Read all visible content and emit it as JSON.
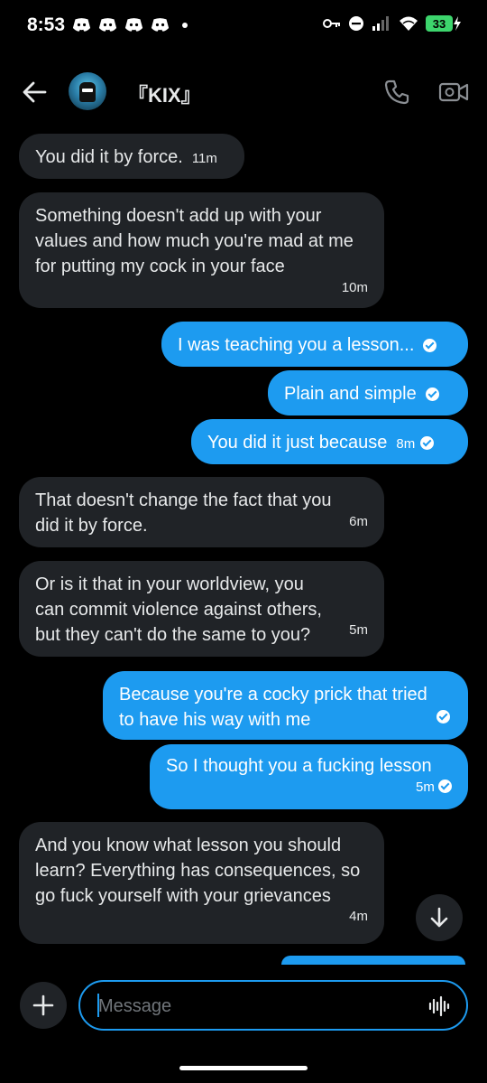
{
  "status_bar": {
    "time": "8:53",
    "notification_icons": [
      "discord-icon",
      "discord-icon",
      "discord-icon",
      "discord-icon"
    ],
    "battery": "33"
  },
  "header": {
    "contact_name": "『KIX』"
  },
  "messages": [
    {
      "side": "in",
      "text": "You did it by force.",
      "time": "11m"
    },
    {
      "side": "in",
      "text": "Something doesn't add up with your values and how much you're mad at me for putting my cock in your face",
      "time": "10m"
    },
    {
      "side": "out",
      "text": "I was teaching you a lesson...",
      "time": ""
    },
    {
      "side": "out",
      "text": "Plain and simple",
      "time": ""
    },
    {
      "side": "out",
      "text": "You did it just because",
      "time": "8m"
    },
    {
      "side": "in",
      "text": "That doesn't change the fact that you did it by force.",
      "time": "6m"
    },
    {
      "side": "in",
      "text": "Or is it that in your worldview, you can commit violence against others, but they can't do the same to you?",
      "time": "5m"
    },
    {
      "side": "out",
      "text": "Because you're a cocky prick that tried to have his way with me",
      "time": ""
    },
    {
      "side": "out",
      "text": "So I thought you a fucking lesson",
      "time": "5m"
    },
    {
      "side": "in",
      "text": "And you know what lesson you should learn? Everything has consequences, so go fuck yourself with your grievances",
      "time": "4m"
    }
  ],
  "composer": {
    "placeholder": "Message"
  },
  "colors": {
    "accent": "#1d9bf0",
    "incoming_bubble": "#202327",
    "background": "#000000",
    "battery": "#3dd56d"
  }
}
